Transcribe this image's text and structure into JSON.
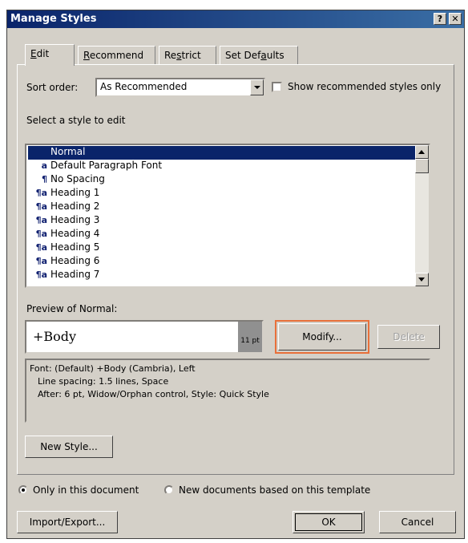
{
  "window": {
    "title": "Manage Styles",
    "help_button": "?",
    "close_button": "✕"
  },
  "tabs": [
    {
      "label": "Edit",
      "mnemonic_index": 0,
      "active": true
    },
    {
      "label": "Recommend",
      "mnemonic_index": 0,
      "active": false
    },
    {
      "label": "Restrict",
      "mnemonic_index": 2,
      "active": false
    },
    {
      "label": "Set Defaults",
      "mnemonic_index": 7,
      "active": false
    }
  ],
  "sort": {
    "label": "Sort order:",
    "value": "As Recommended"
  },
  "show_recommended": {
    "label": "Show recommended styles only",
    "checked": false
  },
  "select_label": "Select a style to edit",
  "styles": [
    {
      "icon": "",
      "name": "Normal",
      "selected": true
    },
    {
      "icon": "a",
      "name": "Default Paragraph Font"
    },
    {
      "icon": "¶",
      "name": "No Spacing"
    },
    {
      "icon": "¶a",
      "name": "Heading 1"
    },
    {
      "icon": "¶a",
      "name": "Heading 2"
    },
    {
      "icon": "¶a",
      "name": "Heading 3"
    },
    {
      "icon": "¶a",
      "name": "Heading 4"
    },
    {
      "icon": "¶a",
      "name": "Heading 5"
    },
    {
      "icon": "¶a",
      "name": "Heading 6"
    },
    {
      "icon": "¶a",
      "name": "Heading 7"
    }
  ],
  "preview": {
    "label": "Preview of Normal:",
    "sample": "+Body",
    "size": "11 pt"
  },
  "buttons": {
    "modify": "Modify...",
    "delete": "Delete",
    "new_style": "New Style...",
    "import_export": "Import/Export...",
    "ok": "OK",
    "cancel": "Cancel"
  },
  "description": [
    "Font: (Default) +Body (Cambria), Left",
    "Line spacing:  1.5 lines, Space",
    "After:  6 pt, Widow/Orphan control, Style: Quick Style"
  ],
  "scope": {
    "only_document": "Only in this document",
    "new_documents": "New documents based on this template",
    "selected": "only_document"
  }
}
